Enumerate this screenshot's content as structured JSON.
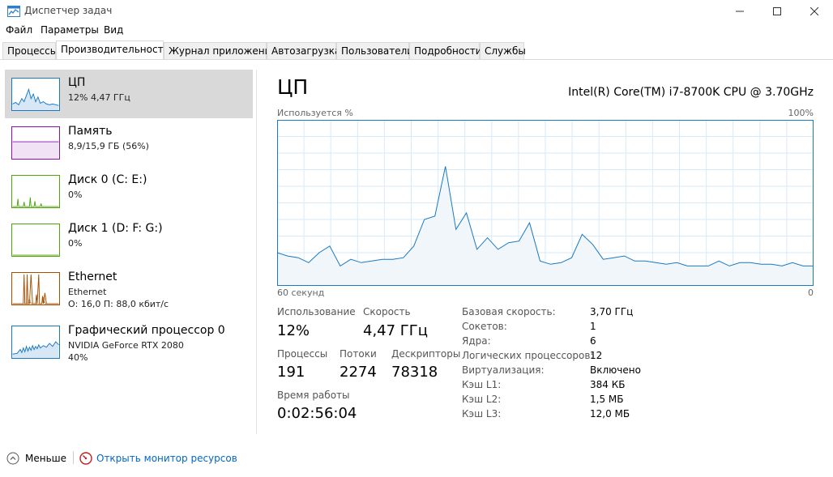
{
  "window": {
    "title": "Диспетчер задач"
  },
  "menu": [
    "Файл",
    "Параметры",
    "Вид"
  ],
  "tabs": [
    "Процессы",
    "Производительность",
    "Журнал приложений",
    "Автозагрузка",
    "Пользователи",
    "Подробности",
    "Службы"
  ],
  "sidebar": {
    "items": [
      {
        "title": "ЦП",
        "sub1": "12% 4,47 ГГц",
        "sub2": "",
        "sub3": "",
        "color": "#1979c3"
      },
      {
        "title": "Память",
        "sub1": "8,9/15,9 ГБ (56%)",
        "sub2": "",
        "sub3": "",
        "color": "#8b12ae"
      },
      {
        "title": "Диск 0 (C: E:)",
        "sub1": "0%",
        "sub2": "",
        "sub3": "",
        "color": "#4da60c"
      },
      {
        "title": "Диск 1 (D: F: G:)",
        "sub1": "0%",
        "sub2": "",
        "sub3": "",
        "color": "#4da60c"
      },
      {
        "title": "Ethernet",
        "sub1": "Ethernet",
        "sub2": "О: 16,0 П: 88,0 кбит/с",
        "sub3": "",
        "color": "#a74f01"
      },
      {
        "title": "Графический процессор 0",
        "sub1": "NVIDIA GeForce RTX 2080",
        "sub2": "40%",
        "sub3": "",
        "color": "#1979c3"
      }
    ]
  },
  "main": {
    "title": "ЦП",
    "model": "Intel(R) Core(TM) i7-8700K CPU @ 3.70GHz",
    "graph_label": "Используется %",
    "graph_max": "100%",
    "axis_left": "60 секунд",
    "axis_right": "0",
    "stats": {
      "usage_label": "Использование",
      "usage_value": "12%",
      "speed_label": "Скорость",
      "speed_value": "4,47 ГГц",
      "processes_label": "Процессы",
      "processes_value": "191",
      "threads_label": "Потоки",
      "threads_value": "2274",
      "handles_label": "Дескрипторы",
      "handles_value": "78318",
      "uptime_label": "Время работы",
      "uptime_value": "0:02:56:04"
    },
    "specs": [
      {
        "label": "Базовая скорость:",
        "value": "3,70 ГГц"
      },
      {
        "label": "Сокетов:",
        "value": "1"
      },
      {
        "label": "Ядра:",
        "value": "6"
      },
      {
        "label": "Логических процессоров:",
        "value": "12"
      },
      {
        "label": "Виртуализация:",
        "value": "Включено"
      },
      {
        "label": "Кэш L1:",
        "value": "384 КБ"
      },
      {
        "label": "Кэш L2:",
        "value": "1,5 МБ"
      },
      {
        "label": "Кэш L3:",
        "value": "12,0 МБ"
      }
    ]
  },
  "cpu_history": [
    20,
    18,
    17,
    14,
    20,
    24,
    12,
    16,
    14,
    15,
    16,
    16,
    17,
    24,
    40,
    42,
    72,
    34,
    44,
    22,
    29,
    22,
    26,
    27,
    38,
    15,
    13,
    14,
    17,
    31,
    25,
    16,
    17,
    18,
    15,
    15,
    14,
    13,
    14,
    12,
    12,
    12,
    15,
    12,
    14,
    14,
    13,
    13,
    12,
    14,
    12,
    12
  ],
  "footer": {
    "fewer_label": "Меньше",
    "resmon_label": "Открыть монитор ресурсов"
  },
  "colors": {
    "cpu": "#1979c3",
    "memory": "#8b12ae",
    "disk": "#4da60c",
    "ethernet": "#a74f01",
    "accent_link": "#0066cc"
  }
}
